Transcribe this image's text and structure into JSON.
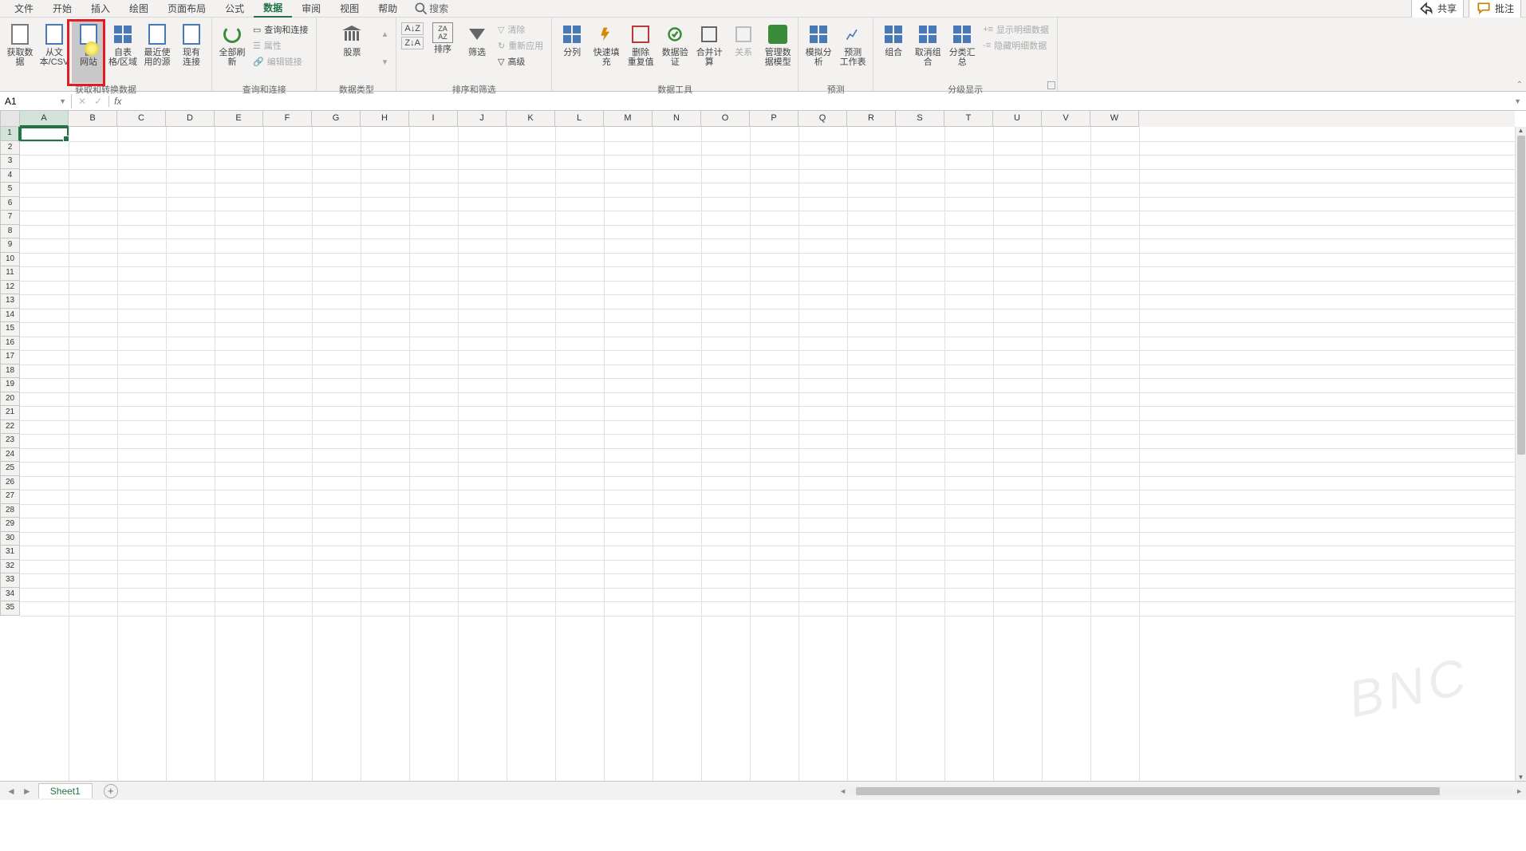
{
  "tabs": {
    "file": "文件",
    "home": "开始",
    "insert": "插入",
    "draw": "绘图",
    "page_layout": "页面布局",
    "formulas": "公式",
    "data": "数据",
    "review": "审阅",
    "view": "视图",
    "help": "帮助",
    "search": "搜索"
  },
  "header_right": {
    "share": "共享",
    "comments": "批注"
  },
  "groups": {
    "get_transform": {
      "label": "获取和转换数据",
      "get_data": "获取数\n据",
      "from_csv": "从文\n本/CSV",
      "from_web": "自\n网站",
      "from_table": "自表\n格/区域",
      "recent_sources": "最近使\n用的源",
      "existing_conn": "现有\n连接"
    },
    "queries": {
      "label": "查询和连接",
      "refresh_all": "全部刷新",
      "queries_conn": "查询和连接",
      "properties": "属性",
      "edit_links": "编辑链接"
    },
    "data_types": {
      "label": "数据类型",
      "stocks": "股票"
    },
    "sort_filter": {
      "label": "排序和筛选",
      "sort": "排序",
      "filter": "筛选",
      "clear": "清除",
      "reapply": "重新应用",
      "advanced": "高级"
    },
    "data_tools": {
      "label": "数据工具",
      "text_to_cols": "分列",
      "flash_fill": "快速填充",
      "remove_dup": "删除\n重复值",
      "data_valid": "数据验\n证",
      "consolidate": "合并计算",
      "relationships": "关系",
      "data_model": "管理数\n据模型"
    },
    "forecast": {
      "label": "预测",
      "whatif": "模拟分析",
      "forecast_sheet": "预测\n工作表"
    },
    "outline": {
      "label": "分级显示",
      "group": "组合",
      "ungroup": "取消组合",
      "subtotal": "分类汇总",
      "show_detail": "显示明细数据",
      "hide_detail": "隐藏明细数据"
    }
  },
  "namebox": {
    "value": "A1"
  },
  "columns": [
    "A",
    "B",
    "C",
    "D",
    "E",
    "F",
    "G",
    "H",
    "I",
    "J",
    "K",
    "L",
    "M",
    "N",
    "O",
    "P",
    "Q",
    "R",
    "S",
    "T",
    "U",
    "V",
    "W"
  ],
  "rows_count": 35,
  "sheet_tabs": {
    "sheet1": "Sheet1"
  },
  "watermark": "BNC"
}
